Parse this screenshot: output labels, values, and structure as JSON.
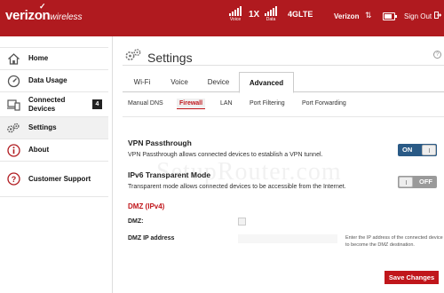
{
  "header": {
    "brand_name": "verizon",
    "brand_sub": "wireless",
    "status": [
      {
        "label": "Voice",
        "bars": 5
      },
      {
        "label": "Data",
        "bars": 5
      }
    ],
    "network_1x": "1X",
    "network_4g": "4GLTE",
    "carrier": "Verizon",
    "signout_label": "Sign Out",
    "battery_level": 0.8
  },
  "sidebar": {
    "items": [
      {
        "label": "Home",
        "icon": "house-icon"
      },
      {
        "label": "Data Usage",
        "icon": "meter-icon"
      },
      {
        "label": "Connected\nDevices",
        "icon": "devices-icon",
        "badge": "4"
      },
      {
        "label": "Settings",
        "icon": "gears-icon",
        "active": true
      },
      {
        "label": "About",
        "icon": "info-icon"
      },
      {
        "label": "Customer Support",
        "icon": "question-icon"
      }
    ]
  },
  "main": {
    "title": "Settings",
    "help_icon": "?",
    "tabs": [
      "Wi-Fi",
      "Voice",
      "Device",
      "Advanced"
    ],
    "active_tab": "Advanced",
    "subtabs": [
      "Manual DNS",
      "Firewall",
      "LAN",
      "Port Filtering",
      "Port Forwarding"
    ],
    "active_subtab": "Firewall",
    "vpn": {
      "title": "VPN Passthrough",
      "desc": "VPN Passthrough allows connected devices to establish a VPN tunnel.",
      "state": "ON"
    },
    "ipv6": {
      "title": "IPv6 Transparent Mode",
      "desc": "Transparent mode allows connected devices to be accessible from the Internet.",
      "state": "OFF"
    },
    "dmz": {
      "title": "DMZ (IPv4)",
      "checkbox_label": "DMZ:",
      "ip_label": "DMZ IP address",
      "ip_value": "",
      "hint": "Enter the IP address of the connected device to become the DMZ destination."
    },
    "save_label": "Save Changes"
  },
  "watermark": "SetupRouter.com",
  "colors": {
    "brand_red": "#b01a1f",
    "accent_red": "#c0161b",
    "toggle_on": "#2a5a86",
    "toggle_off": "#9a9a9a"
  }
}
